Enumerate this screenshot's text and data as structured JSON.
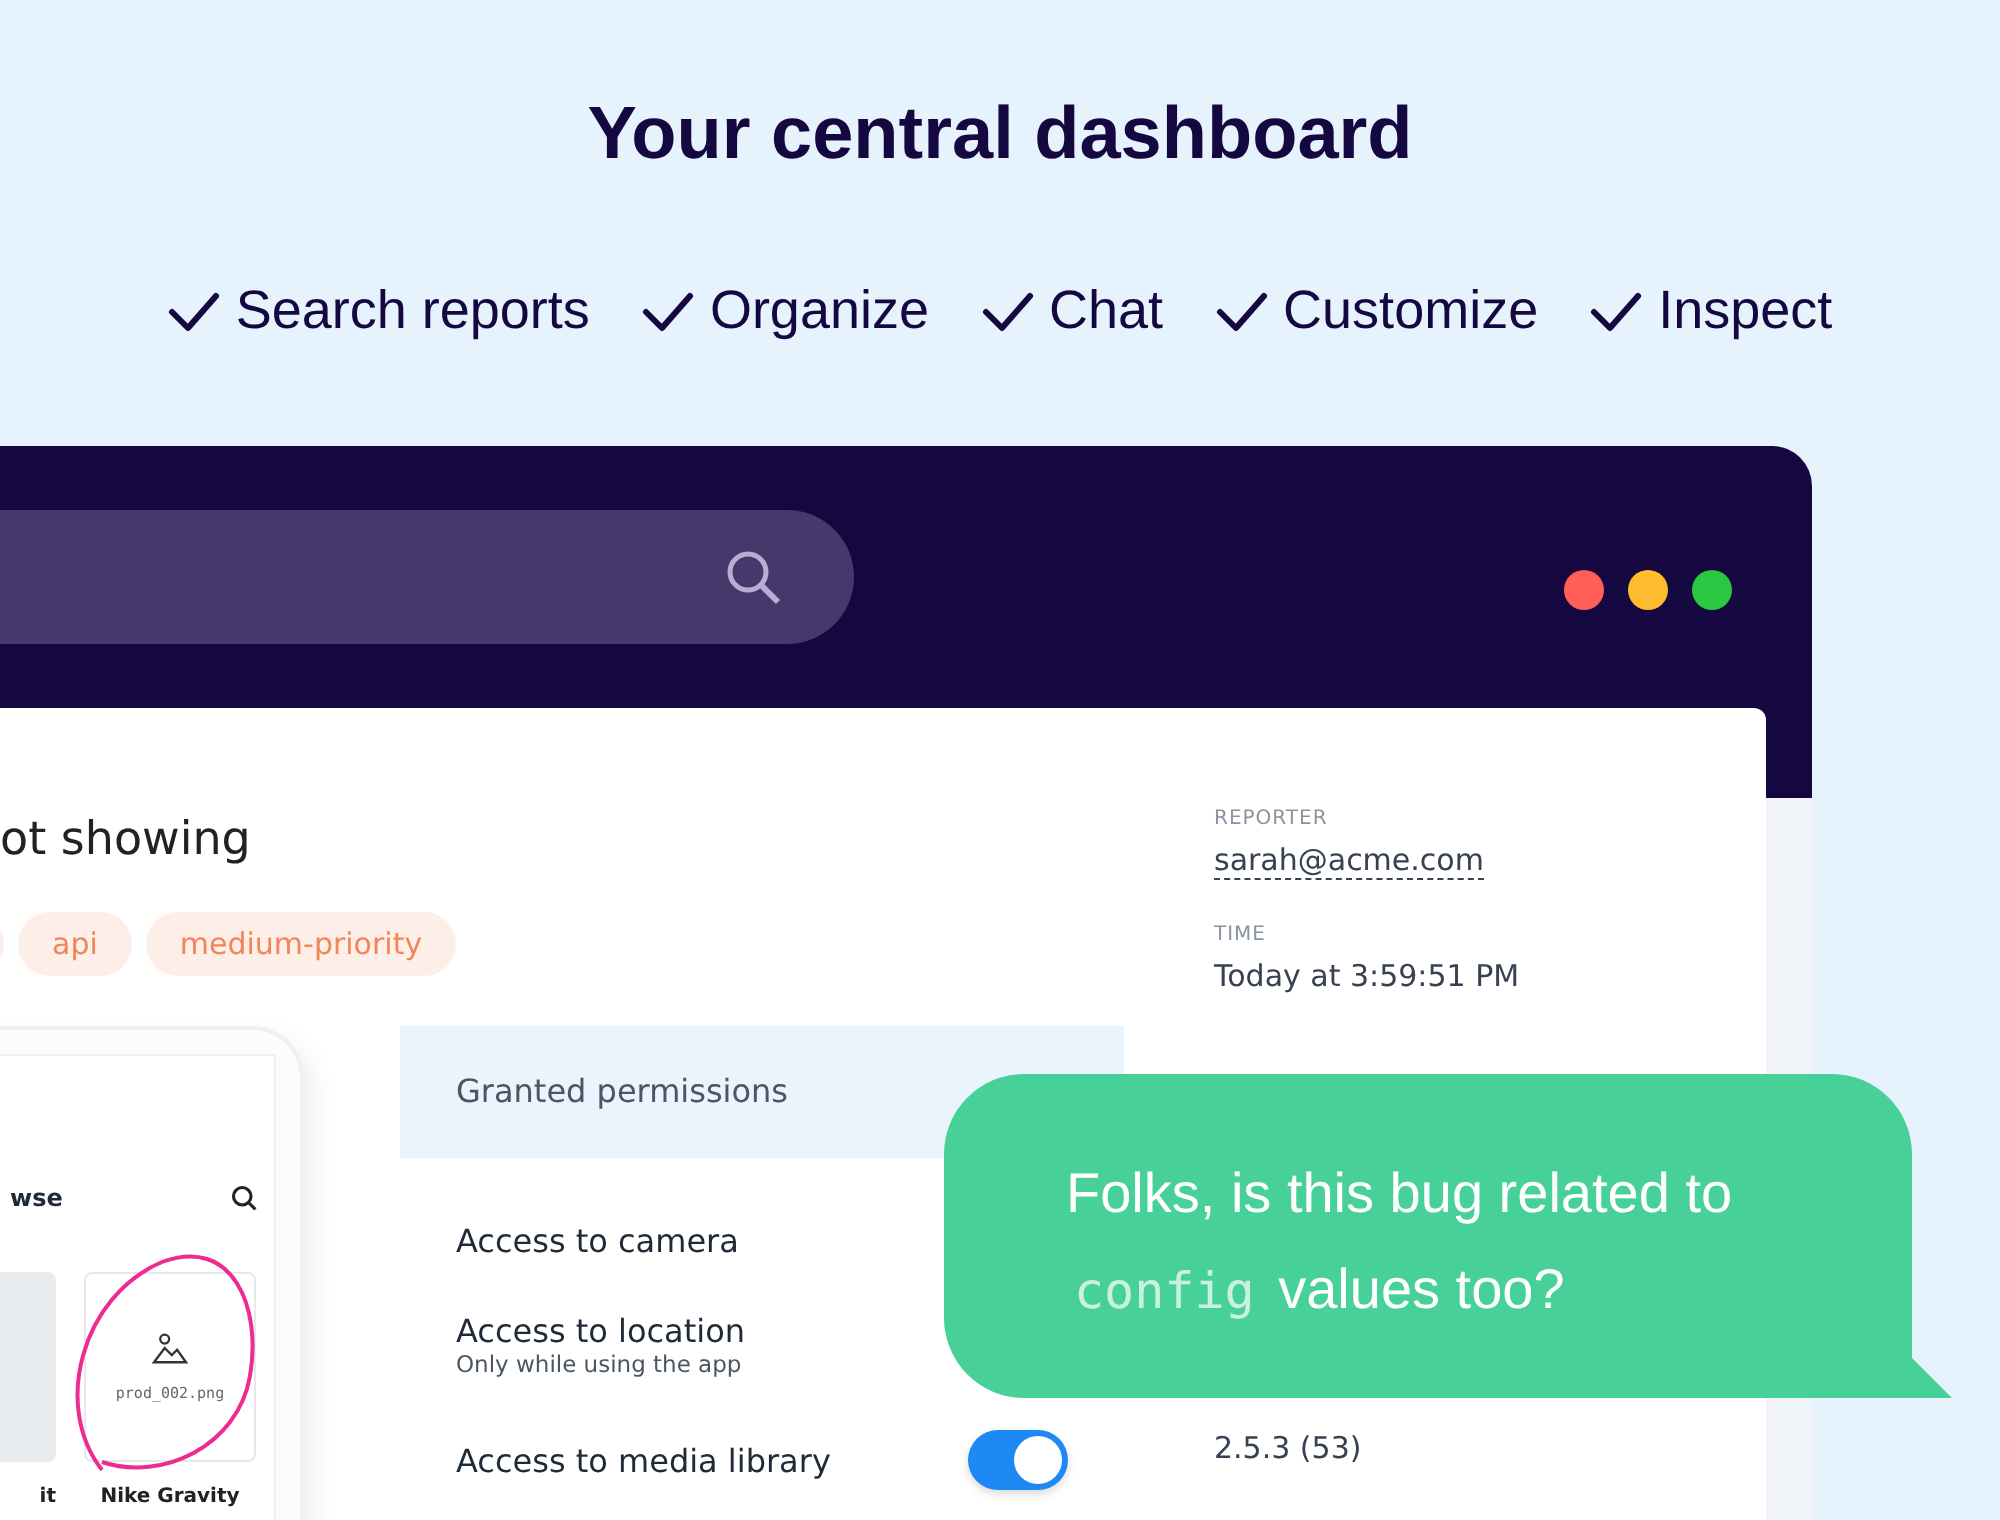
{
  "heading": "Your central dashboard",
  "features": [
    "Search reports",
    "Organize",
    "Chat",
    "Customize",
    "Inspect"
  ],
  "issue": {
    "title": "ot showing",
    "tags": [
      "api",
      "medium-priority"
    ]
  },
  "phone": {
    "header": "wse",
    "items": [
      {
        "label": "it",
        "kind": "photo"
      },
      {
        "label": "Nike Gravity",
        "kind": "placeholder",
        "filename": "prod_002.png",
        "annotated": true
      }
    ]
  },
  "permissions": {
    "title": "Granted permissions",
    "rows": [
      {
        "label": "Access to camera"
      },
      {
        "label": "Access to location",
        "detail": "Only while using the app"
      },
      {
        "label": "Access to media library",
        "on": true
      }
    ]
  },
  "details": [
    {
      "label": "REPORTER",
      "value": "sarah@acme.com",
      "kind": "link"
    },
    {
      "label": "TIME",
      "value": "Today at 3:59:51 PM",
      "kind": "text"
    },
    {
      "value": "2.5.3 (53)",
      "kind": "text"
    }
  ],
  "chat": {
    "before": "Folks, is this bug related to",
    "code": "config",
    "after": "values too?"
  }
}
